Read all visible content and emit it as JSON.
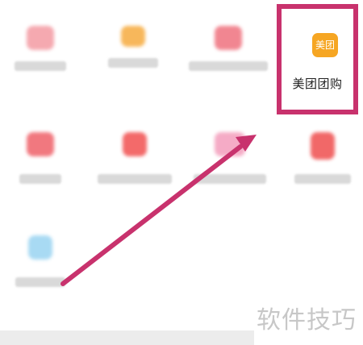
{
  "highlighted_app": {
    "icon_text": "美团",
    "label": "美团团购",
    "icon_color": "#f6a623"
  },
  "annotation": {
    "color": "#c8326d",
    "type": "arrow pointing to highlighted app"
  },
  "watermark": {
    "text": "软件技巧"
  },
  "blurred_tiles": [
    {
      "icon_color": "#f4a0a8"
    },
    {
      "icon_color": "#f7b04a"
    },
    {
      "icon_color": "#f07a86"
    },
    {
      "icon_color": "#f06a72"
    },
    {
      "icon_color": "#f25a5a"
    },
    {
      "icon_color": "#f4a3c0"
    },
    {
      "icon_color": "#f05858"
    },
    {
      "icon_color": "#9fd6f2"
    }
  ]
}
